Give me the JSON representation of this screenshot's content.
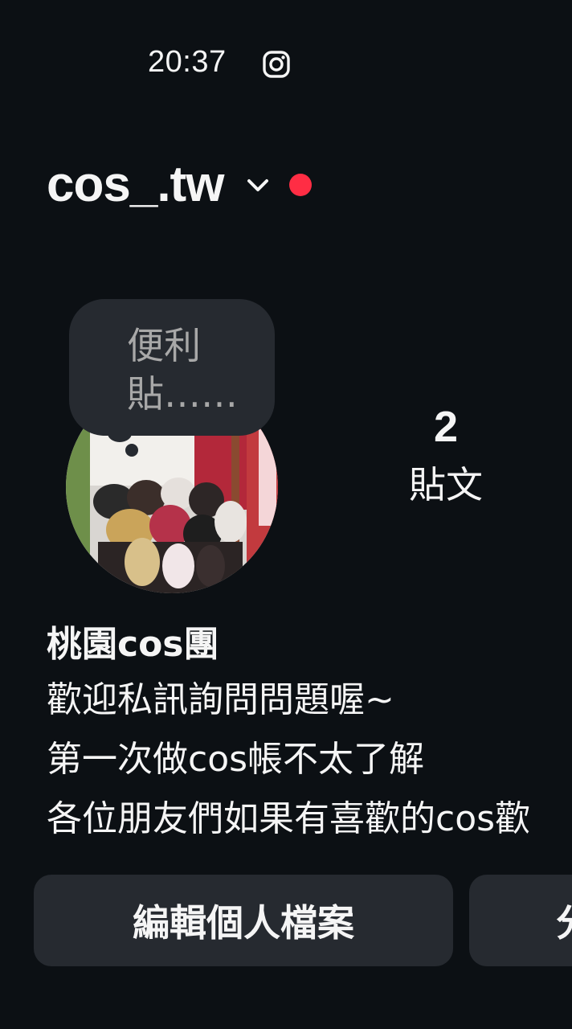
{
  "status_bar": {
    "time": "20:37",
    "app_icon": "instagram-icon"
  },
  "header": {
    "username": "cos_.tw",
    "dropdown_icon": "chevron-down-icon",
    "notification_dot_color": "#ff2d44"
  },
  "note": {
    "text": "便利貼……"
  },
  "avatar": {
    "description": "profile photo"
  },
  "stats": {
    "posts_count": "2",
    "posts_label": "貼文"
  },
  "bio": {
    "name": "桃園cos團",
    "lines": [
      "歡迎私訊詢問問題喔~",
      "第一次做cos帳不太了解",
      "各位朋友們如果有喜歡的cos歡"
    ]
  },
  "buttons": {
    "edit_profile": "編輯個人檔案",
    "share_profile": "分"
  },
  "colors": {
    "background": "#0c1014",
    "button_bg": "#262a30",
    "accent_red": "#ff2d44"
  }
}
